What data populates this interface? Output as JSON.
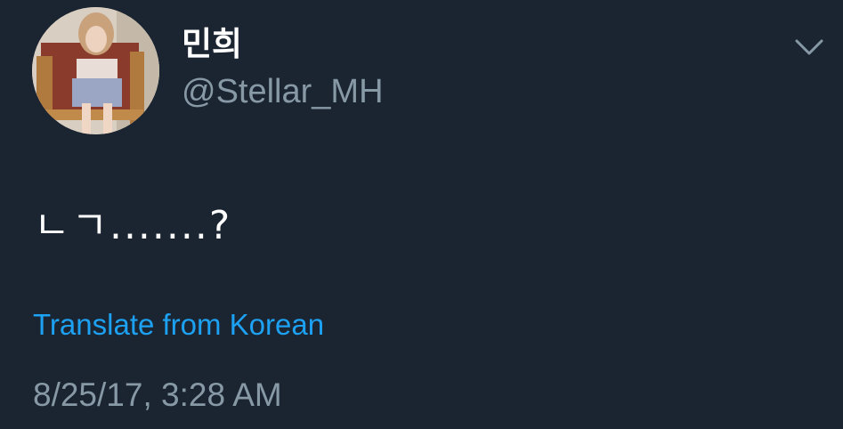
{
  "tweet": {
    "author": {
      "display_name": "민희",
      "handle": "@Stellar_MH",
      "avatar_icon": "profile-photo"
    },
    "text": "ㄴㄱ.......?",
    "translate_label": "Translate from Korean",
    "timestamp": "8/25/17, 3:28 AM",
    "menu_icon": "chevron-down-icon"
  },
  "theme": {
    "background": "#1b2431",
    "primary_text": "#ffffff",
    "secondary_text": "#8899a6",
    "link": "#1da1f2"
  }
}
